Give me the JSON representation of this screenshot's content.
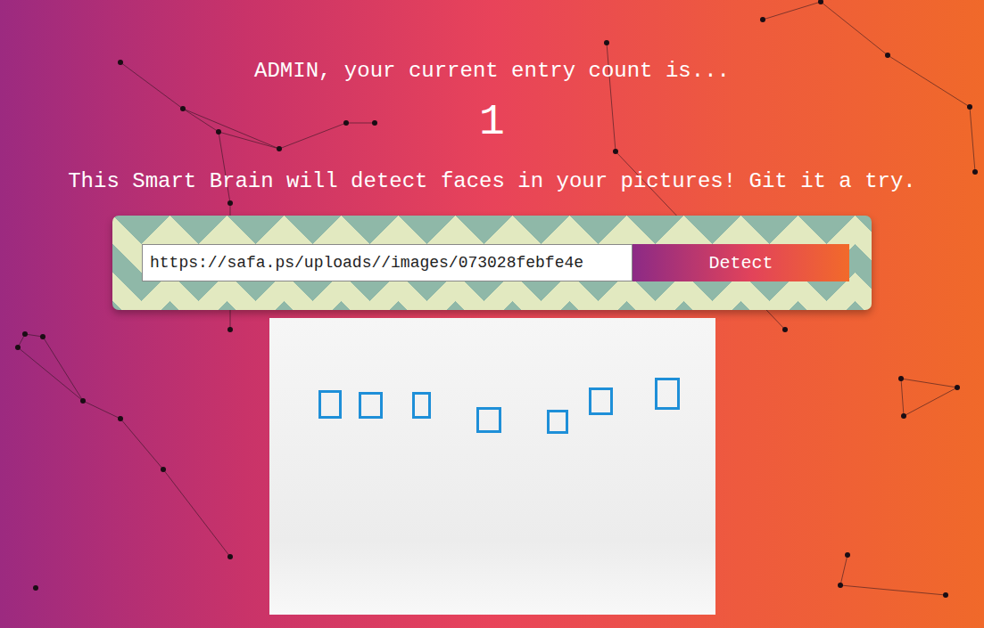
{
  "greeting": "ADMIN, your current entry count is...",
  "entry_count": "1",
  "tagline": "This Smart Brain will detect faces in your pictures! Git it a try.",
  "form": {
    "input_value": "https://safa.ps/uploads//images/073028febfe4e",
    "button": "Detect"
  }
}
